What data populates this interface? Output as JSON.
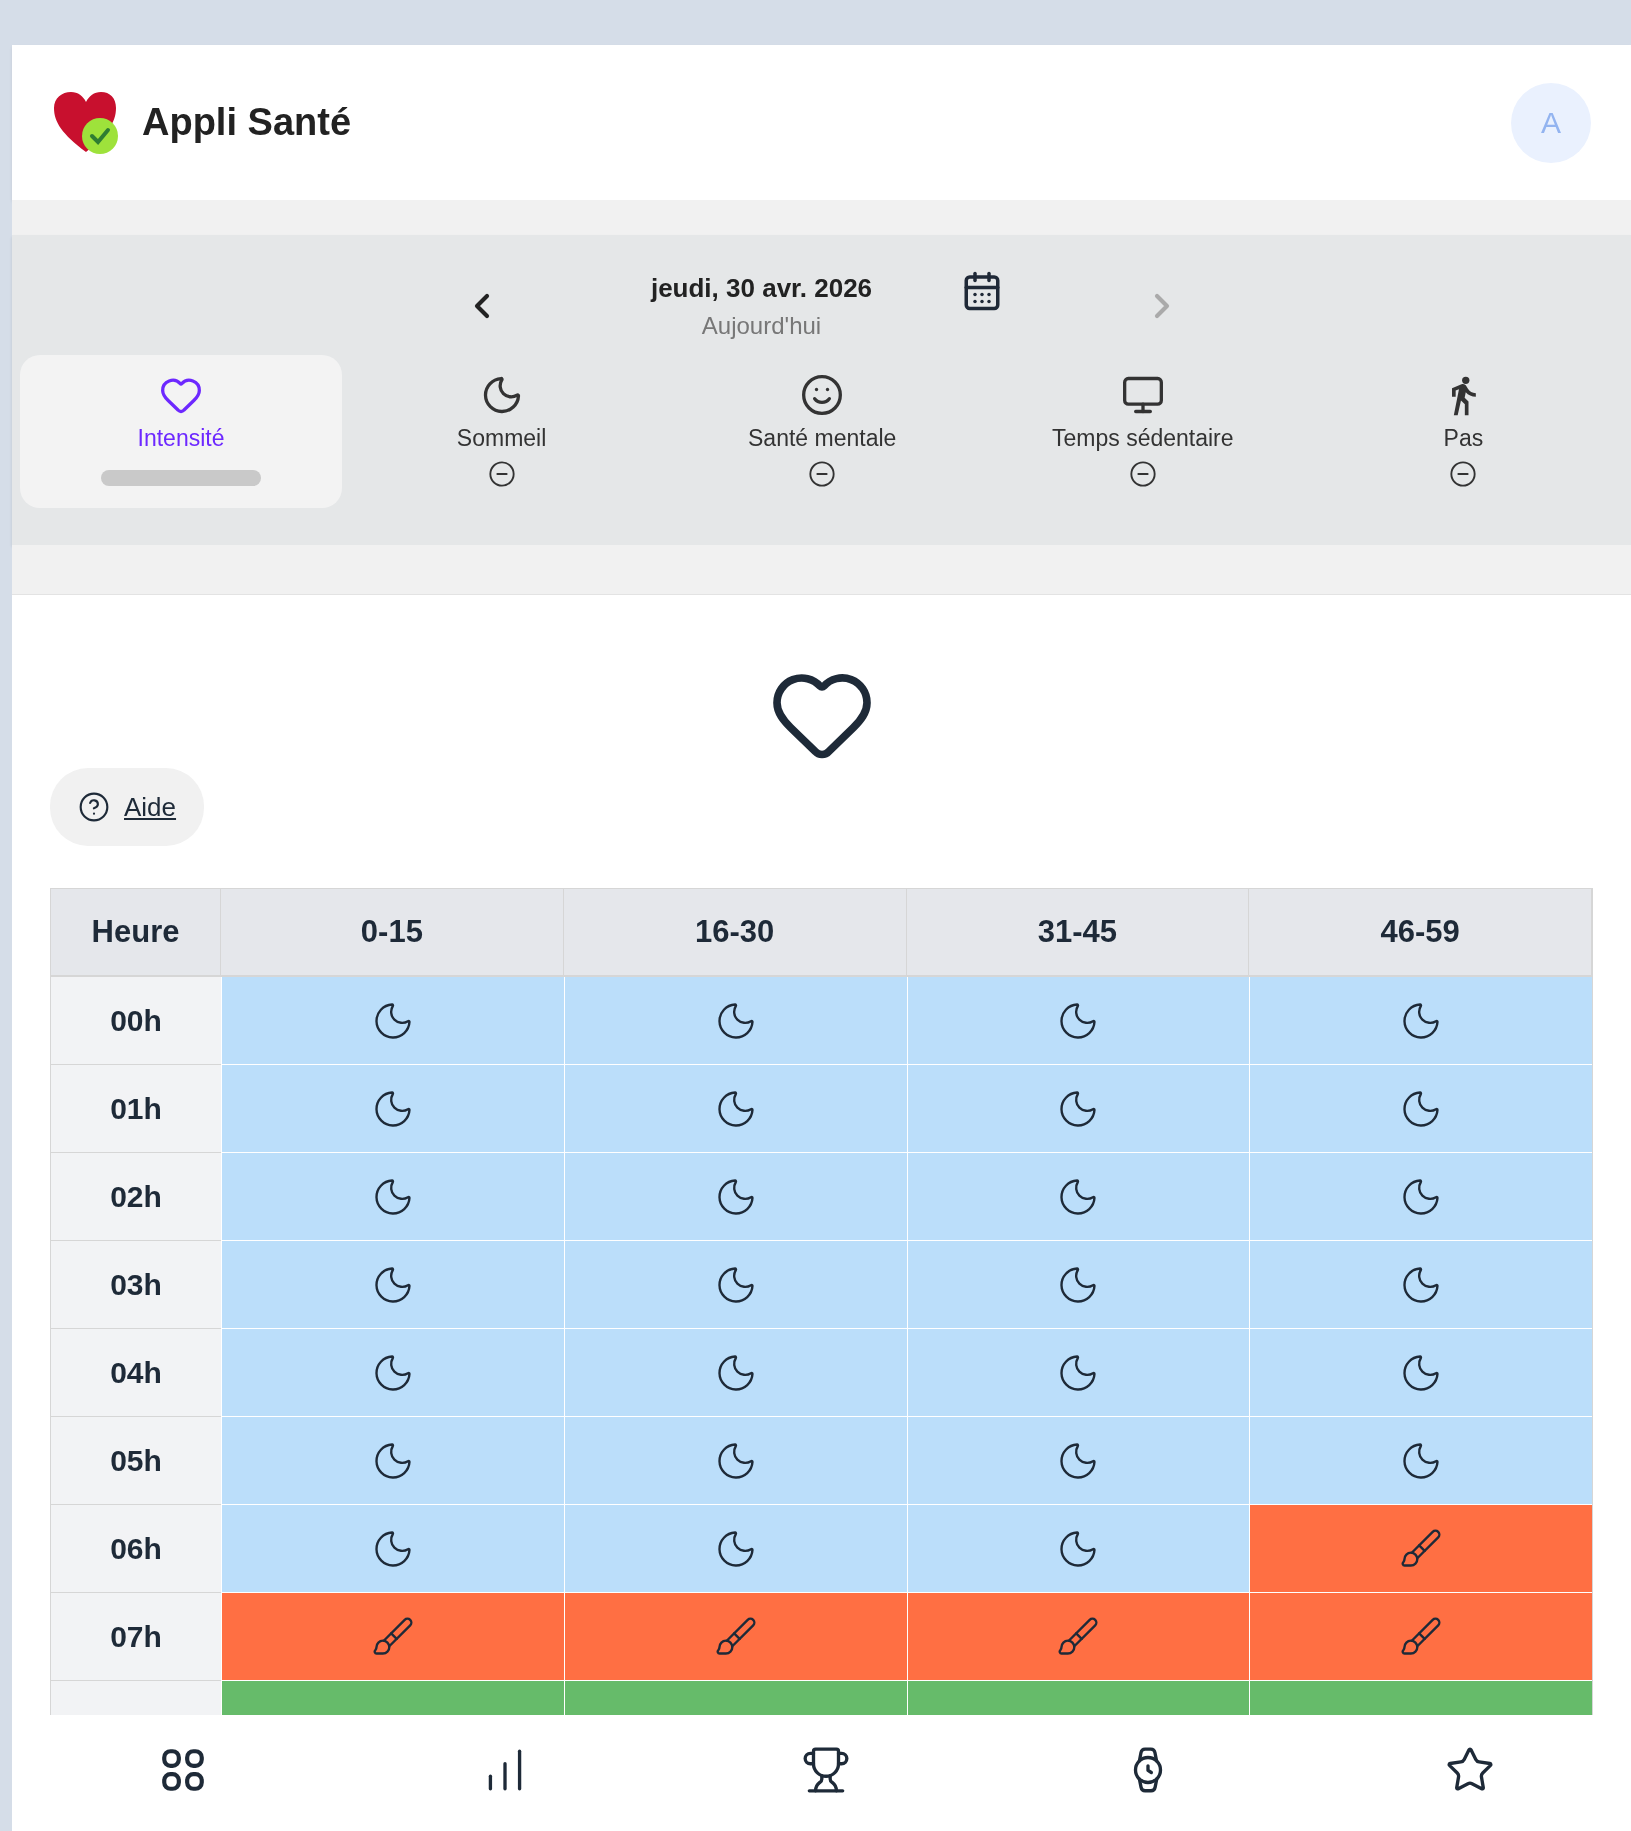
{
  "app": {
    "title": "Appli Santé",
    "avatar": "A"
  },
  "date_nav": {
    "date": "jeudi, 30 avr. 2026",
    "subtitle": "Aujourd'hui",
    "prev_disabled": false,
    "next_disabled": true
  },
  "tabs": [
    {
      "label": "Intensité",
      "kind": "intensity",
      "selected": true
    },
    {
      "label": "Sommeil",
      "kind": "sleep",
      "selected": false
    },
    {
      "label": "Santé mentale",
      "kind": "mental",
      "selected": false
    },
    {
      "label": "Temps sédentaire",
      "kind": "sedentary",
      "selected": false
    },
    {
      "label": "Pas",
      "kind": "steps",
      "selected": false
    }
  ],
  "help_link": "Aide",
  "table": {
    "columns": [
      "Heure",
      "0-15",
      "16-30",
      "31-45",
      "46-59"
    ],
    "rows": [
      {
        "hour": "00h",
        "cells": [
          {
            "kind": "sleep"
          },
          {
            "kind": "sleep"
          },
          {
            "kind": "sleep"
          },
          {
            "kind": "sleep"
          }
        ]
      },
      {
        "hour": "01h",
        "cells": [
          {
            "kind": "sleep"
          },
          {
            "kind": "sleep"
          },
          {
            "kind": "sleep"
          },
          {
            "kind": "sleep"
          }
        ]
      },
      {
        "hour": "02h",
        "cells": [
          {
            "kind": "sleep"
          },
          {
            "kind": "sleep"
          },
          {
            "kind": "sleep"
          },
          {
            "kind": "sleep"
          }
        ]
      },
      {
        "hour": "03h",
        "cells": [
          {
            "kind": "sleep"
          },
          {
            "kind": "sleep"
          },
          {
            "kind": "sleep"
          },
          {
            "kind": "sleep"
          }
        ]
      },
      {
        "hour": "04h",
        "cells": [
          {
            "kind": "sleep"
          },
          {
            "kind": "sleep"
          },
          {
            "kind": "sleep"
          },
          {
            "kind": "sleep"
          }
        ]
      },
      {
        "hour": "05h",
        "cells": [
          {
            "kind": "sleep"
          },
          {
            "kind": "sleep"
          },
          {
            "kind": "sleep"
          },
          {
            "kind": "sleep"
          }
        ]
      },
      {
        "hour": "06h",
        "cells": [
          {
            "kind": "sleep"
          },
          {
            "kind": "sleep"
          },
          {
            "kind": "sleep"
          },
          {
            "kind": "active"
          }
        ]
      },
      {
        "hour": "07h",
        "cells": [
          {
            "kind": "active"
          },
          {
            "kind": "active"
          },
          {
            "kind": "active"
          },
          {
            "kind": "active"
          }
        ]
      },
      {
        "cells": [
          {
            "kind": "light"
          },
          {
            "kind": "light"
          },
          {
            "kind": "light"
          },
          {
            "kind": "light"
          }
        ]
      }
    ]
  },
  "bottom_nav": [
    {
      "kind": "grid"
    },
    {
      "kind": "stats"
    },
    {
      "kind": "trophy"
    },
    {
      "kind": "watch"
    },
    {
      "kind": "star"
    }
  ]
}
